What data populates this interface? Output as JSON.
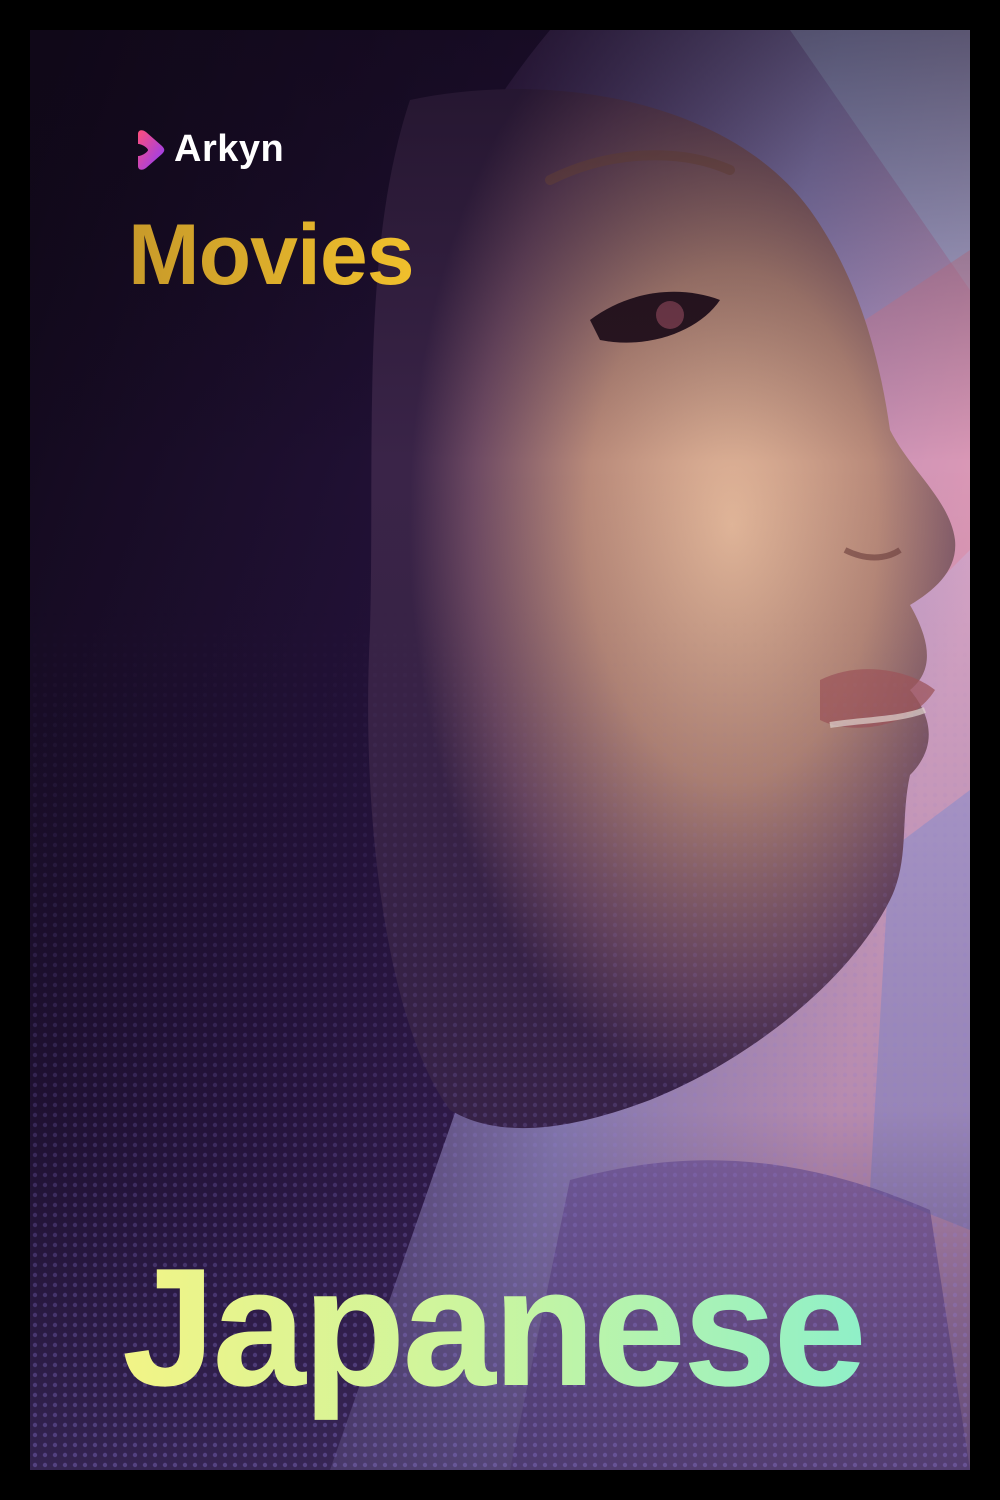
{
  "brand": {
    "name": "Arkyn",
    "icon": "play-heart-icon"
  },
  "section": {
    "title": "Movies"
  },
  "category": {
    "title": "Japanese"
  },
  "colors": {
    "brand_icon_start": "#ff4e7a",
    "brand_icon_end": "#8a3cff",
    "section_gold_start": "#c89a2a",
    "section_gold_end": "#f0c02c",
    "category_start": "#f2f486",
    "category_end": "#8ff0c8",
    "frame": "#000000"
  }
}
